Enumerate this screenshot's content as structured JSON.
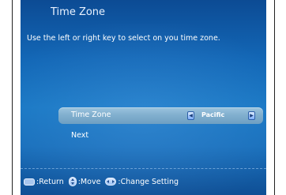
{
  "screen": {
    "title": "Time Zone",
    "instructions": "Use the left or right key to select on you time zone."
  },
  "menu": {
    "time_zone": {
      "label": "Time Zone",
      "value": "Pacific",
      "left_arrow_icon": "left-arrow-icon",
      "right_arrow_icon": "right-arrow-icon"
    },
    "next": {
      "label": "Next"
    }
  },
  "footer": {
    "return_icon": "menu-button-icon",
    "return_label": ":Return",
    "move_icon": "up-down-button-icon",
    "move_label": ":Move",
    "change_icon": "left-right-button-icon",
    "change_label": ":Change Setting"
  },
  "colors": {
    "background_top": "#0c4b94",
    "background_mid": "#1a78c4",
    "selected_row": "#82b0cf",
    "text": "#ffffff"
  }
}
